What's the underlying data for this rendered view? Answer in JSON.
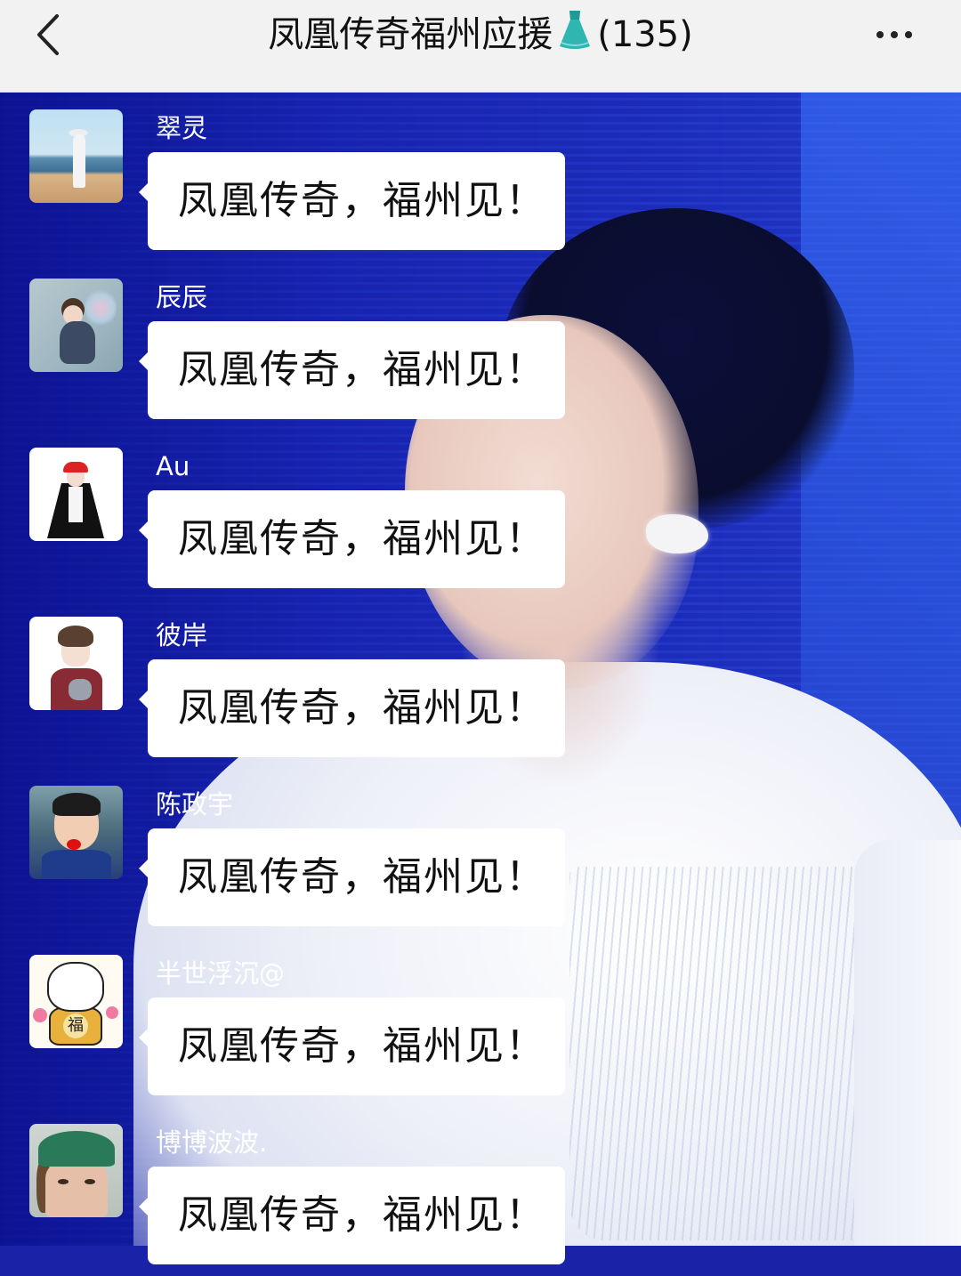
{
  "header": {
    "title": "凤凰传奇福州应援",
    "emoji": "dress",
    "member_count": "(135)"
  },
  "messages": [
    {
      "sender": "翠灵",
      "text": "凤凰传奇，福州见！"
    },
    {
      "sender": "辰辰",
      "text": "凤凰传奇，福州见！"
    },
    {
      "sender": "Au",
      "text": "凤凰传奇，福州见！"
    },
    {
      "sender": "彼岸",
      "text": "凤凰传奇，福州见！"
    },
    {
      "sender": "陈政宇",
      "text": "凤凰传奇，福州见！"
    },
    {
      "sender": "半世浮沉@",
      "text": "凤凰传奇，福州见！"
    },
    {
      "sender": "博博波波.",
      "text": "凤凰传奇，福州见！"
    }
  ],
  "avatar_badge_text": "福",
  "icons": {
    "back": "chevron-left-icon",
    "more": "more-horizontal-icon",
    "dress": "dress-emoji-icon"
  },
  "colors": {
    "header_bg": "#f2f2f2",
    "bubble_bg": "#ffffff",
    "chat_bg": "#1a22a8",
    "dress_emoji": "#2fb6b0"
  }
}
